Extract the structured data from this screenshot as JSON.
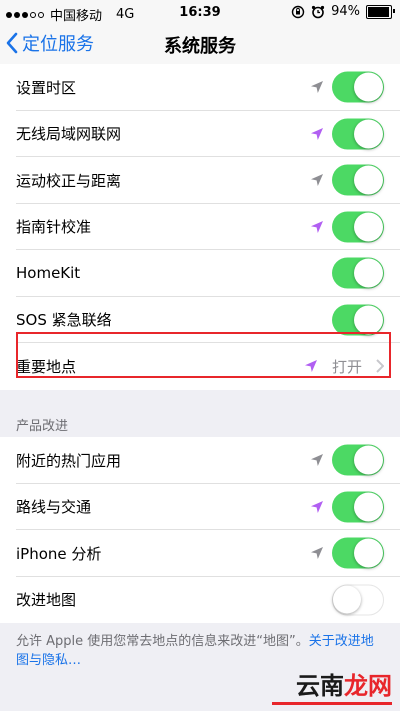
{
  "status_bar": {
    "carrier": "中国移动",
    "network": "4G",
    "time": "16:39",
    "battery": "94%",
    "battery_level": 0.94
  },
  "nav": {
    "back_label": "定位服务",
    "title": "系统服务"
  },
  "group1": [
    {
      "label": "设置时区",
      "location_icon": "gray",
      "toggle": "on"
    },
    {
      "label": "无线局域网联网",
      "location_icon": "purple",
      "toggle": "on"
    },
    {
      "label": "运动校正与距离",
      "location_icon": "gray",
      "toggle": "on"
    },
    {
      "label": "指南针校准",
      "location_icon": "purple",
      "toggle": "on"
    },
    {
      "label": "HomeKit",
      "location_icon": "none",
      "toggle": "on"
    },
    {
      "label": "SOS 紧急联络",
      "location_icon": "none",
      "toggle": "on"
    },
    {
      "label": "重要地点",
      "location_icon": "purple",
      "detail": "打开",
      "chevron": true
    }
  ],
  "section_header": "产品改进",
  "group2": [
    {
      "label": "附近的热门应用",
      "location_icon": "gray",
      "toggle": "on"
    },
    {
      "label": "路线与交通",
      "location_icon": "purple",
      "toggle": "on"
    },
    {
      "label": "iPhone 分析",
      "location_icon": "gray",
      "toggle": "on"
    },
    {
      "label": "改进地图",
      "location_icon": "none",
      "toggle": "off"
    }
  ],
  "footer": {
    "text": "允许 Apple 使用您常去地点的信息来改进“地图”。",
    "link": "关于改进地图与隐私…"
  },
  "colors": {
    "accent": "#1a73e8",
    "toggle_on": "#4cd964",
    "location_purple": "#b15ff2",
    "location_gray": "#8e8e93",
    "highlight": "#e8262b"
  },
  "watermark": {
    "text_black": "云南",
    "text_red": "龙网"
  }
}
